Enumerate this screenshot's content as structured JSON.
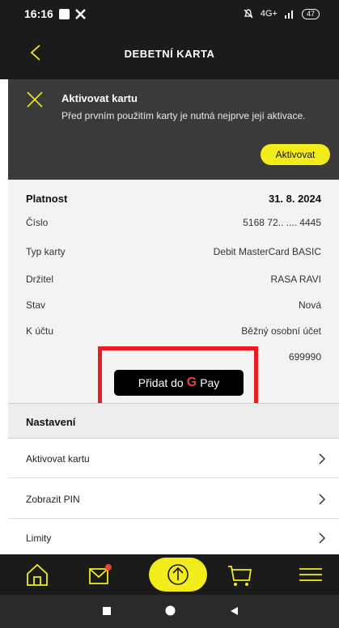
{
  "status_bar": {
    "time": "16:16",
    "signal": "4G+",
    "battery": "47"
  },
  "header": {
    "title": "DEBETNÍ KARTA"
  },
  "banner": {
    "title": "Aktivovat kartu",
    "text": "Před prvním použitím karty je nutná nejprve její aktivace.",
    "button_label": "Aktivovat"
  },
  "details": {
    "rows": [
      {
        "label": "Platnost",
        "value": "31. 8. 2024"
      },
      {
        "label": "Číslo",
        "value": "5168 72.. .... 4445"
      },
      {
        "label": "Typ karty",
        "value": "Debit MasterCard BASIC"
      },
      {
        "label": "Držitel",
        "value": "RASA RAVI"
      },
      {
        "label": "Stav",
        "value": "Nová"
      },
      {
        "label": "K účtu",
        "value": "Běžný osobní účet"
      }
    ],
    "account_number": "699990"
  },
  "gpay": {
    "prefix": "Přidat do",
    "g": "G",
    "pay": "Pay"
  },
  "settings": {
    "heading": "Nastavení",
    "items": [
      {
        "label": "Aktivovat kartu"
      },
      {
        "label": "Zobrazit PIN"
      },
      {
        "label": "Limity"
      }
    ]
  },
  "colors": {
    "accent": "#f2ec1b",
    "dark": "#1b1b1b",
    "highlight": "#ea1c22"
  },
  "icons": {
    "nav": [
      "home-icon",
      "mail-icon",
      "upload-icon",
      "cart-icon",
      "menu-icon"
    ]
  }
}
